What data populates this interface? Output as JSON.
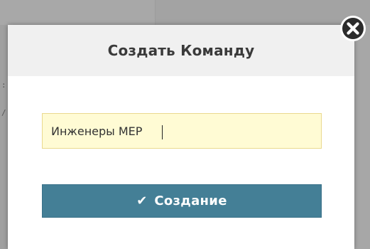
{
  "dialog": {
    "title": "Создать Команду",
    "close_icon": "close-circle-icon",
    "team_name_input": {
      "value": "Инженеры MEP",
      "placeholder": ""
    },
    "create_button": {
      "icon": "check-icon",
      "label": "Создание"
    }
  },
  "colors": {
    "header_bg": "#f0f0f0",
    "input_bg": "#fffbd4",
    "input_border": "#ead98e",
    "button_bg": "#447f96",
    "overlay": "#a7a7a7"
  },
  "background": {
    "strip_chars": [
      ":",
      "/"
    ]
  }
}
